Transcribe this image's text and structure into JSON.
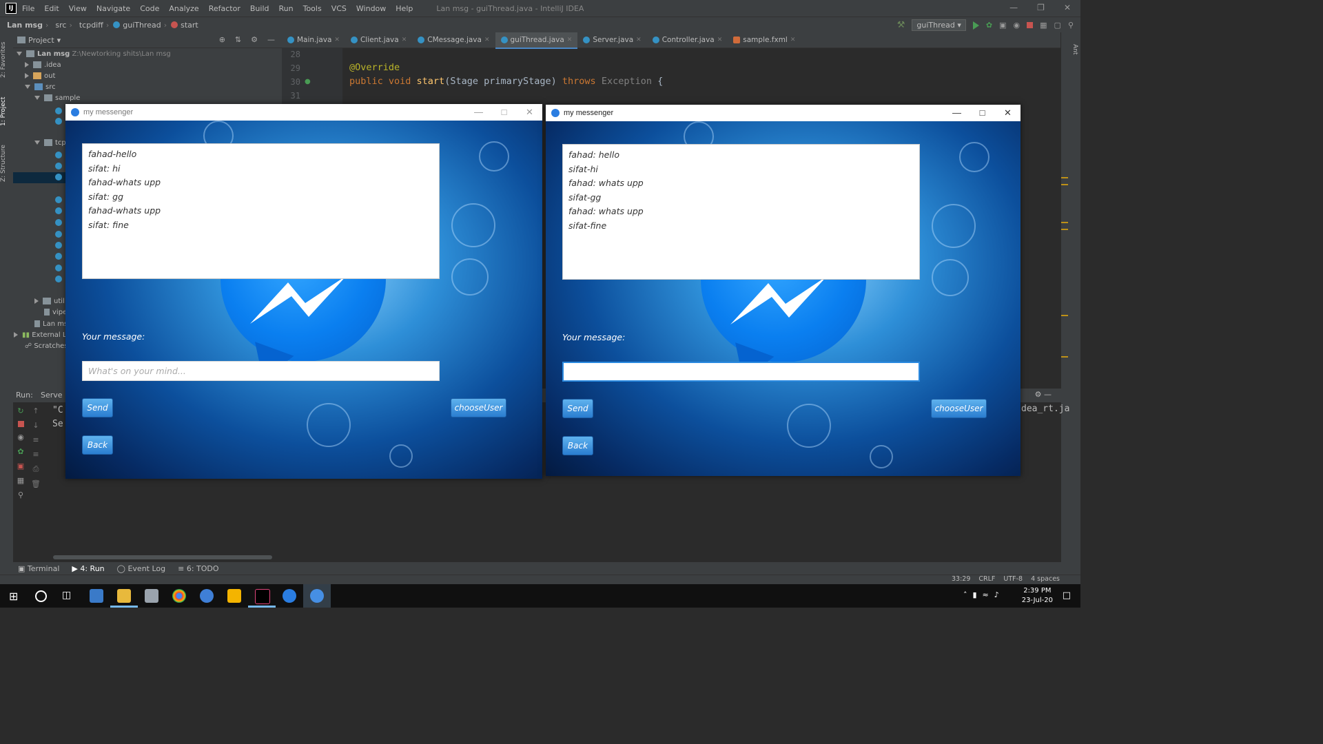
{
  "ide": {
    "menu": [
      "File",
      "Edit",
      "View",
      "Navigate",
      "Code",
      "Analyze",
      "Refactor",
      "Build",
      "Run",
      "Tools",
      "VCS",
      "Window",
      "Help"
    ],
    "window_title": "Lan msg - guiThread.java - IntelliJ IDEA",
    "breadcrumbs": [
      "Lan msg",
      "src",
      "tcpdiff",
      "guiThread",
      "start"
    ],
    "run_config": "guiThread",
    "project_label": "Project",
    "project_root": "Lan msg",
    "project_path": "Z:\\Newtorking shits\\Lan msg",
    "tree": [
      ".idea",
      "out",
      "src",
      "sample",
      "tcp",
      "util",
      "vipe",
      "Lan ms",
      "External Li",
      "Scratches"
    ],
    "left_tabs": [
      "2: Favorites",
      "1: Project",
      "Z: Structure"
    ],
    "tabs": [
      "Main.java",
      "Client.java",
      "CMessage.java",
      "guiThread.java",
      "Server.java",
      "Controller.java",
      "sample.fxml"
    ],
    "line_numbers": [
      "28",
      "29",
      "30",
      "31"
    ],
    "code_line_1": "@Override",
    "code_kw1": "public void",
    "code_fn": "start",
    "code_params": "(Stage primaryStage)",
    "code_kw2": "throws",
    "code_exc": "Exception",
    "code_brace": "{",
    "run_label": "Run:",
    "run_tab": "Serve",
    "console_left": [
      "\"C",
      "Se"
    ],
    "console_right": "dea_rt.ja",
    "bottom_tabs": [
      "Terminal",
      "4: Run",
      "Event Log",
      "6: TODO"
    ],
    "status": {
      "pos": "33:29",
      "eol": "CRLF",
      "enc": "UTF-8",
      "indent": "4 spaces"
    },
    "right_tab": "Ant"
  },
  "taskbar": {
    "time": "2:39 PM",
    "date": "23-Jul-20"
  },
  "messenger_left": {
    "title": "my messenger",
    "messages": [
      "fahad-hello",
      "sifat: hi",
      "fahad-whats upp",
      "sifat: gg",
      "fahad-whats upp",
      "sifat: fine"
    ],
    "message_label": "Your message:",
    "input_placeholder": "What's on your mind...",
    "input_value": "",
    "send_label": "Send",
    "choose_user_label": "chooseUser",
    "back_label": "Back"
  },
  "messenger_right": {
    "title": "my messenger",
    "messages": [
      "fahad: hello",
      "sifat-hi",
      "fahad: whats upp",
      "sifat-gg",
      "fahad: whats upp",
      "sifat-fine"
    ],
    "message_label": "Your message:",
    "input_placeholder": "",
    "input_value": "",
    "send_label": "Send",
    "choose_user_label": "chooseUser",
    "back_label": "Back"
  }
}
